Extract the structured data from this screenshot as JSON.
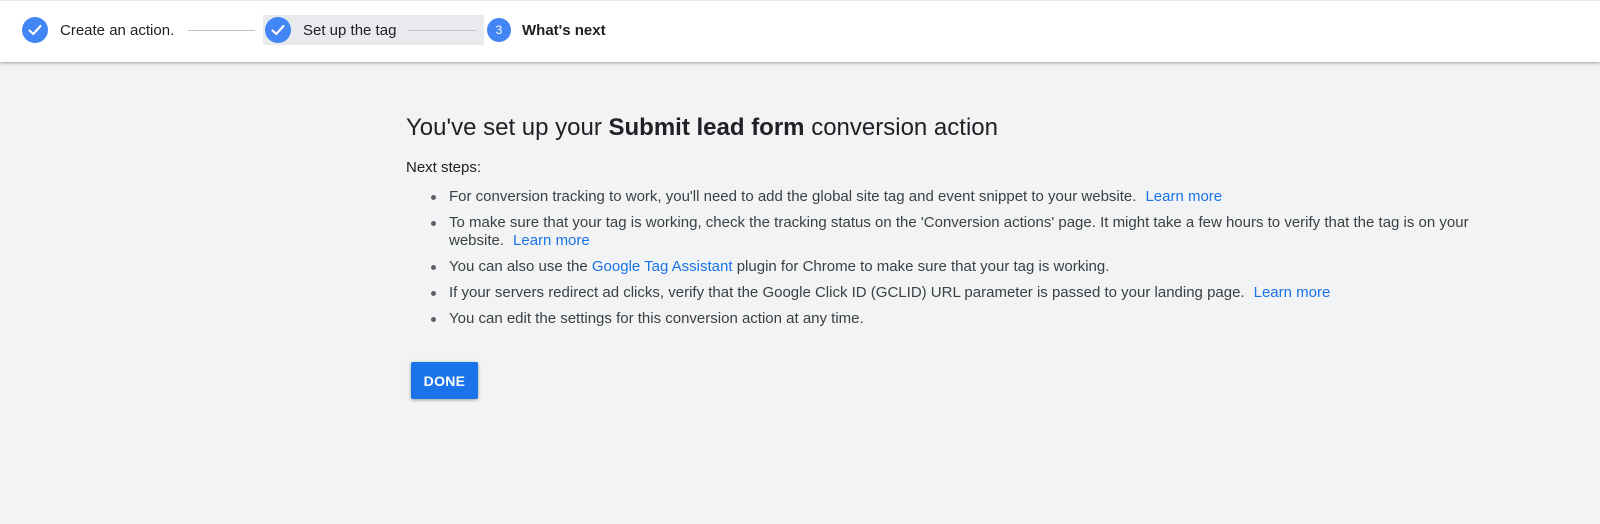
{
  "stepper": {
    "steps": [
      {
        "label": "Create an action.",
        "state": "complete"
      },
      {
        "label": "Set up the tag",
        "state": "complete"
      },
      {
        "label": "What's next",
        "number": "3",
        "state": "current"
      }
    ]
  },
  "main": {
    "headline_prefix": "You've set up your ",
    "headline_action": "Submit lead form",
    "headline_suffix": " conversion action",
    "next_steps_label": "Next steps:",
    "bullets": [
      {
        "text": "For conversion tracking to work, you'll need to add the global site tag and event snippet to your website.",
        "link": "Learn more"
      },
      {
        "text": "To make sure that your tag is working, check the tracking status on the 'Conversion actions' page. It might take a few hours to verify that the tag is on your website.",
        "link": "Learn more"
      },
      {
        "text_before": "You can also use the ",
        "link": "Google Tag Assistant",
        "text_after": " plugin for Chrome to make sure that your tag is working."
      },
      {
        "text": "If your servers redirect ad clicks, verify that the Google Click ID (GCLID) URL parameter is passed to your landing page.",
        "link": "Learn more"
      },
      {
        "text": "You can edit the settings for this conversion action at any time."
      }
    ],
    "done_label": "DONE"
  },
  "colors": {
    "accent": "#1a73e8",
    "step_icon": "#4285f4",
    "background": "#f1f3f4"
  },
  "icons": {
    "complete": "checkmark-icon"
  }
}
